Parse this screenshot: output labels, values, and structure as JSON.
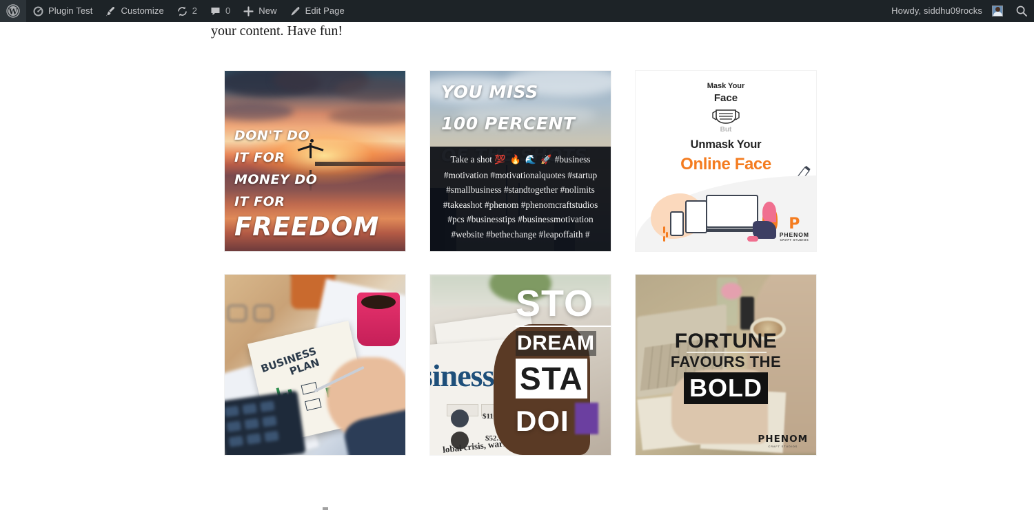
{
  "adminbar": {
    "background": "#1d2327",
    "left_items": [
      {
        "name": "wp-logo",
        "label": "",
        "icon": "wordpress-icon"
      },
      {
        "name": "site-name",
        "label": "Plugin Test",
        "icon": "dashboard-icon"
      },
      {
        "name": "customize",
        "label": "Customize",
        "icon": "paintbrush-icon"
      },
      {
        "name": "updates",
        "label": "2",
        "icon": "updates-icon"
      },
      {
        "name": "comments",
        "label": "0",
        "icon": "comment-bubble-icon"
      },
      {
        "name": "new-content",
        "label": "New",
        "icon": "plus-icon"
      },
      {
        "name": "edit-page",
        "label": "Edit Page",
        "icon": "pencil-icon"
      }
    ],
    "account": {
      "greeting": "Howdy, siddhu09rocks"
    },
    "search": {
      "icon": "search-icon"
    }
  },
  "page": {
    "intro_text": "your content. Have fun!"
  },
  "grid": {
    "tiles": [
      {
        "name": "instagram-post-1",
        "alt": "Sunset beach silhouette motivational quote",
        "kind": "photo-quote",
        "quote_lines": [
          "DON'T DO",
          "IT FOR",
          "MONEY DO",
          "IT FOR"
        ],
        "quote_big": "FREEDOM"
      },
      {
        "name": "instagram-post-2",
        "alt": "City skyline with caption overlay",
        "kind": "photo-caption",
        "headline": [
          "YOU MISS",
          "100 PERCENT",
          "OF THE SHOTS"
        ],
        "caption_lead": "Take a shot",
        "caption_emoji": "💯 🔥 🌊 🚀",
        "caption_lines": [
          "#business",
          "#motivation #motivationalquotes #startup",
          "#smallbusiness #standtogether #nolimits",
          "#takeashot #phenom #phenomcraftstudios",
          "#pcs #businesstips #businessmotivation",
          "#website #bethechange #leapoffaith #"
        ]
      },
      {
        "name": "instagram-post-3",
        "alt": "Mask your face but unmask your online face graphic",
        "kind": "graphic",
        "line1": "Mask Your",
        "line2": "Face",
        "line3": "But",
        "line4": "Unmask Your",
        "line5": "Online Face",
        "brand_mark": "P",
        "brand_name": "PHENOM",
        "brand_sub": "CRAFT STUDIOS",
        "accent_color": "#f47c20"
      },
      {
        "name": "instagram-post-4",
        "alt": "Business plan notebook on desk with coffee and calculator",
        "kind": "photo",
        "notebook_line1": "BUSINESS",
        "notebook_line2": "PLAN"
      },
      {
        "name": "instagram-post-5",
        "alt": "Newspaper held in hands with stop dreaming start doing text",
        "kind": "photo-quote",
        "paper_title": "siness",
        "paper_value_1": "$1146.06",
        "paper_value_2": "$52.14",
        "paper_footer": "lobal crisis, warns IMF",
        "overlay_line1": "STO",
        "overlay_line2": "DREAM",
        "overlay_line3": "STA",
        "overlay_line4": "DOI"
      },
      {
        "name": "instagram-post-6",
        "alt": "Fortune favours the bold over laptop desk photo",
        "kind": "photo-quote",
        "line1": "FORTUNE",
        "line2": "FAVOURS THE",
        "line3": "BOLD",
        "brand_name": "PHENOM",
        "brand_sub": "CRAFT STUDIOS"
      }
    ]
  }
}
